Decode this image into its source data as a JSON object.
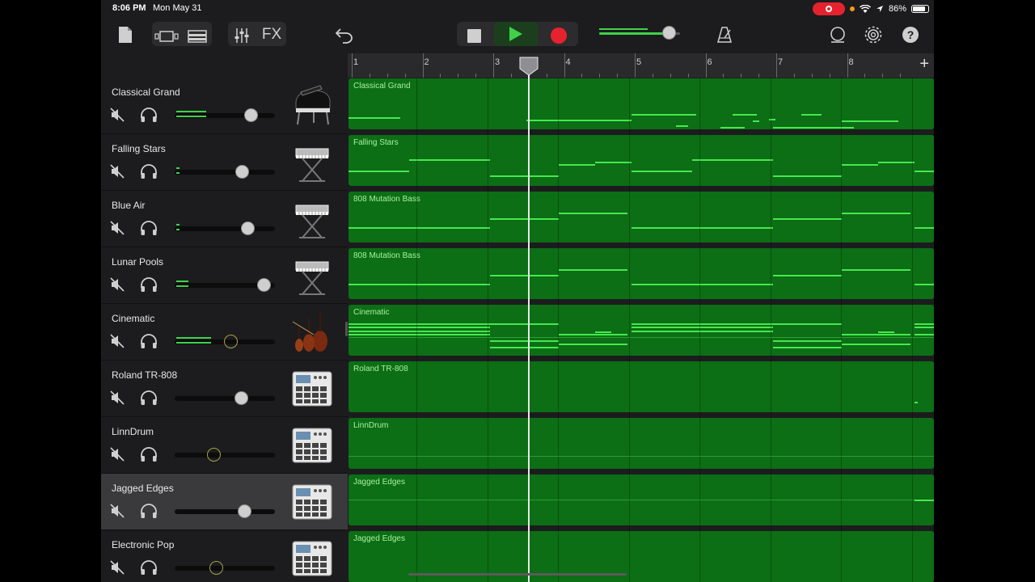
{
  "status": {
    "time": "8:06 PM",
    "date": "Mon May 31",
    "battery": "86%"
  },
  "colors": {
    "region_fill": "#0c6e15",
    "note": "#46e84e",
    "record": "#e5232e",
    "play": "#3fd14a"
  },
  "toolbar": {
    "fx_label": "FX",
    "icons": [
      "my-songs-icon",
      "browser-icon",
      "tracks-view-icon",
      "mixer-icon",
      "fx-button",
      "undo-icon",
      "stop-icon",
      "play-icon",
      "record-icon",
      "master-volume-slider",
      "metronome-icon",
      "loop-browser-icon",
      "settings-icon",
      "help-icon"
    ],
    "master_volume": 0.8
  },
  "ruler": {
    "bars": [
      "1",
      "2",
      "3",
      "4",
      "5",
      "6",
      "7",
      "8"
    ],
    "add_label": "+"
  },
  "tracks": [
    {
      "name": "Classical Grand",
      "region": "Classical Grand",
      "instrument_icon": "grand-piano-icon",
      "volume": 0.8,
      "meter": 0.3
    },
    {
      "name": "Falling Stars",
      "region": "Falling Stars",
      "instrument_icon": "keyboard-icon",
      "volume": 0.7,
      "meter": 0.03
    },
    {
      "name": "Blue Air",
      "region": "808 Mutation Bass",
      "instrument_icon": "keyboard-icon",
      "volume": 0.77,
      "meter": 0.03
    },
    {
      "name": "Lunar Pools",
      "region": "808 Mutation Bass",
      "instrument_icon": "keyboard-icon",
      "volume": 0.95,
      "meter": 0.12
    },
    {
      "name": "Cinematic",
      "region": "Cinematic",
      "instrument_icon": "strings-icon",
      "volume": 0.57,
      "meter": 0.35
    },
    {
      "name": "Roland TR-808",
      "region": "Roland TR-808",
      "instrument_icon": "drum-machine-icon",
      "volume": 0.69,
      "meter": 0
    },
    {
      "name": "LinnDrum",
      "region": "LinnDrum",
      "instrument_icon": "drum-machine-icon",
      "volume": 0.37,
      "meter": 0
    },
    {
      "name": "Jagged Edges",
      "region": "Jagged Edges",
      "instrument_icon": "drum-machine-icon",
      "volume": 0.73,
      "meter": 0,
      "selected": true
    },
    {
      "name": "Electronic Pop",
      "region": "Jagged Edges",
      "instrument_icon": "drum-machine-icon",
      "volume": 0.4,
      "meter": 0
    }
  ]
}
